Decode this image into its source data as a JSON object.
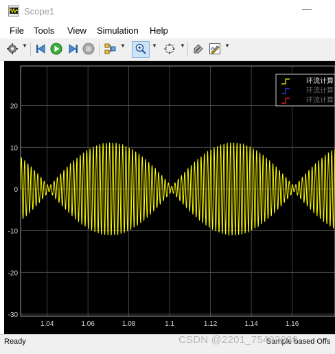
{
  "window": {
    "title": "Scope1",
    "minimize_glyph": "—"
  },
  "menu": [
    "File",
    "Tools",
    "View",
    "Simulation",
    "Help"
  ],
  "toolbar": {
    "icons": [
      "gear-icon",
      "step-back-icon",
      "run-icon",
      "step-forward-icon",
      "stop-icon",
      "signal-selector-icon",
      "zoom-icon",
      "fit-view-icon",
      "highlight-icon",
      "style-icon"
    ]
  },
  "colors": {
    "signal": "#ffff00",
    "axes_bg": "#000000",
    "grid": "#555555",
    "tick_label": "#d8d8d8"
  },
  "legend": {
    "entries": [
      {
        "label": "环流计算",
        "color": "#ffff00"
      },
      {
        "label": "环流计算",
        "color": "#4040ff"
      },
      {
        "label": "环流计算",
        "color": "#ff2020"
      }
    ]
  },
  "status": {
    "ready": "Ready",
    "sample": "Sample based  Offs"
  },
  "watermark": "CSDN @2201_75492830",
  "chart_data": {
    "type": "line",
    "title": "",
    "xlabel": "",
    "ylabel": "",
    "xlim": [
      1.027,
      1.181
    ],
    "ylim": [
      -30.5,
      29.5
    ],
    "xticks": [
      1.04,
      1.06,
      1.08,
      1.1,
      1.12,
      1.14,
      1.16
    ],
    "xtick_labels": [
      "1.04",
      "1.06",
      "1.08",
      "1.1",
      "1.12",
      "1.14",
      "1.16"
    ],
    "yticks": [
      -30,
      -20,
      -10,
      0,
      10,
      20
    ],
    "ytick_labels": [
      "-30",
      "-20",
      "-10",
      "0",
      "10",
      "20"
    ],
    "grid": true,
    "legend_position": "top-right",
    "series": [
      {
        "name": "环流计算",
        "signal": "amplitude-modulated oscillation",
        "beat_minima_x": [
          1.041,
          1.101,
          1.161
        ],
        "beat_maxima_x": [
          1.071,
          1.131
        ],
        "peak_amplitude": 10.5,
        "oscillation_period": 0.0016
      }
    ]
  }
}
